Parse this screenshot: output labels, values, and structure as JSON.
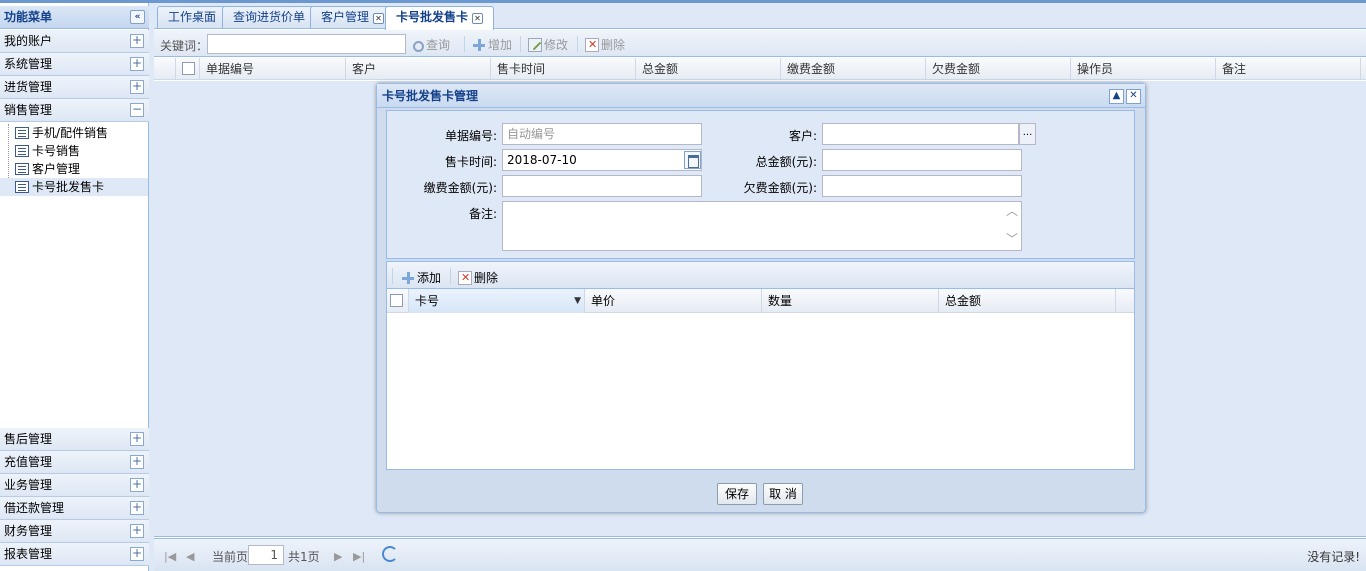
{
  "sidebar": {
    "title": "功能菜单",
    "sections_top": [
      {
        "label": "我的账户",
        "toggle": "+"
      },
      {
        "label": "系统管理",
        "toggle": "+"
      },
      {
        "label": "进货管理",
        "toggle": "+"
      },
      {
        "label": "销售管理",
        "toggle": "−"
      }
    ],
    "tree": [
      "手机/配件销售",
      "卡号销售",
      "客户管理",
      "卡号批发售卡"
    ],
    "sections_bottom": [
      {
        "label": "售后管理",
        "toggle": "+"
      },
      {
        "label": "充值管理",
        "toggle": "+"
      },
      {
        "label": "业务管理",
        "toggle": "+"
      },
      {
        "label": "借还款管理",
        "toggle": "+"
      },
      {
        "label": "财务管理",
        "toggle": "+"
      },
      {
        "label": "报表管理",
        "toggle": "+"
      }
    ]
  },
  "tabs": [
    {
      "label": "工作桌面"
    },
    {
      "label": "查询进货价单"
    },
    {
      "label": "客户管理"
    },
    {
      "label": "卡号批发售卡"
    }
  ],
  "toolbar": {
    "keyword_label": "关键词：",
    "search": "查询",
    "add": "增加",
    "edit": "修改",
    "delete": "删除"
  },
  "grid": {
    "columns": [
      "单据编号",
      "客户",
      "售卡时间",
      "总金额",
      "缴费金额",
      "欠费金额",
      "操作员",
      "备注"
    ]
  },
  "pager": {
    "current_label": "当前页",
    "page": "1",
    "total": "共1页",
    "no_records": "没有记录!"
  },
  "dialog": {
    "title": "卡号批发售卡管理",
    "fields": {
      "doc_no_label": "单据编号:",
      "doc_no_placeholder": "自动编号",
      "customer_label": "客户:",
      "sale_time_label": "售卡时间:",
      "sale_time_value": "2018-07-10",
      "total_label": "总金额(元):",
      "paid_label": "缴费金额(元):",
      "owed_label": "欠费金额(元):",
      "remark_label": "备注:",
      "dots": "..."
    },
    "detail_toolbar": {
      "add": "添加",
      "delete": "删除"
    },
    "detail_columns": [
      "卡号",
      "单价",
      "数量",
      "总金额"
    ],
    "buttons": {
      "save": "保存",
      "cancel": "取 消"
    }
  }
}
